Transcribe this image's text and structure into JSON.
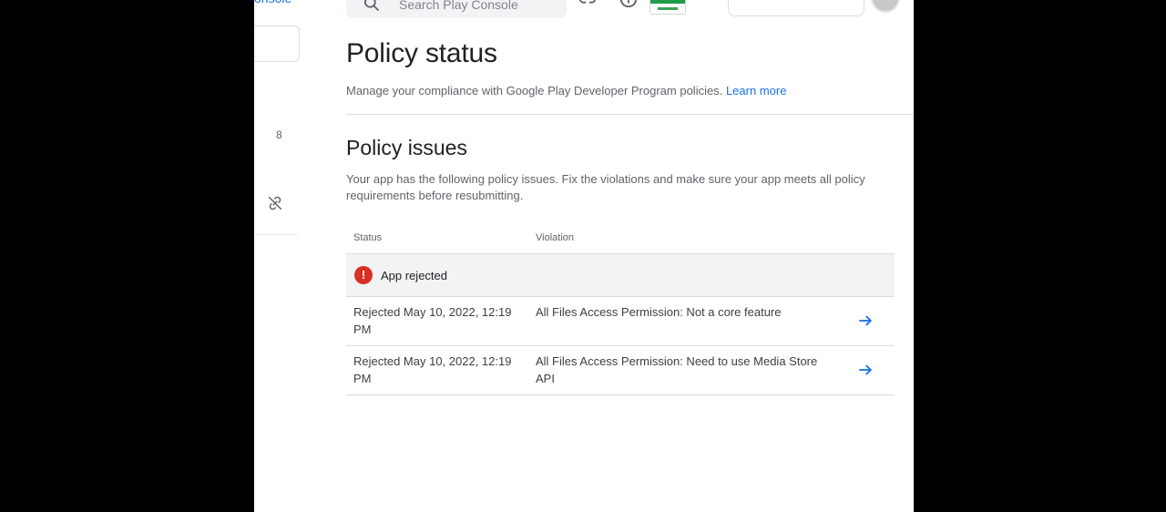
{
  "sidebar": {
    "brand_text": "onsole",
    "badge_count": "8"
  },
  "header": {
    "search_placeholder": "Search Play Console"
  },
  "page": {
    "title": "Policy status",
    "description": "Manage your compliance with Google Play Developer Program policies.",
    "learn_more": "Learn more"
  },
  "issues": {
    "title": "Policy issues",
    "description": "Your app has the following policy issues. Fix the violations and make sure your app meets all policy requirements before resubmitting.",
    "columns": {
      "status": "Status",
      "violation": "Violation"
    },
    "group_label": "App rejected",
    "rows": [
      {
        "status": "Rejected May 10, 2022, 12:19 PM",
        "violation": "All Files Access Permission: Not a core feature"
      },
      {
        "status": "Rejected May 10, 2022, 12:19 PM",
        "violation": "All Files Access Permission: Need to use Media Store API"
      }
    ]
  },
  "colors": {
    "accent": "#1a73e8",
    "error": "#d93025",
    "group_bg": "#f1f3f4"
  }
}
